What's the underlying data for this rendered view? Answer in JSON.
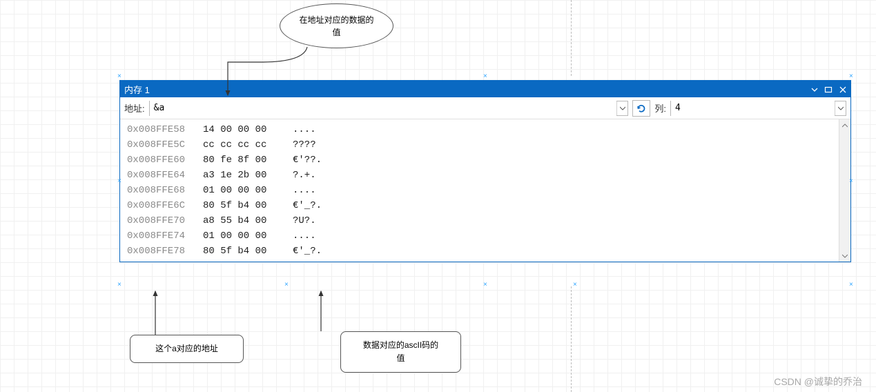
{
  "annotations": {
    "top_ellipse": "在地址对应的数据的\n值",
    "left_box": "这个a对应的地址",
    "right_box": "数据对应的ascII码的\n值"
  },
  "window": {
    "title": "内存 1",
    "addr_label": "地址:",
    "addr_value": "&a",
    "col_label": "列:",
    "col_value": "4"
  },
  "memory": {
    "rows": [
      {
        "addr": "0x008FFE58",
        "hex": "14 00 00 00",
        "asc": "...."
      },
      {
        "addr": "0x008FFE5C",
        "hex": "cc cc cc cc",
        "asc": "????"
      },
      {
        "addr": "0x008FFE60",
        "hex": "80 fe 8f 00",
        "asc": "€'??."
      },
      {
        "addr": "0x008FFE64",
        "hex": "a3 1e 2b 00",
        "asc": "?.+."
      },
      {
        "addr": "0x008FFE68",
        "hex": "01 00 00 00",
        "asc": "...."
      },
      {
        "addr": "0x008FFE6C",
        "hex": "80 5f b4 00",
        "asc": "€'_?."
      },
      {
        "addr": "0x008FFE70",
        "hex": "a8 55 b4 00",
        "asc": "?U?."
      },
      {
        "addr": "0x008FFE74",
        "hex": "01 00 00 00",
        "asc": "...."
      },
      {
        "addr": "0x008FFE78",
        "hex": "80 5f b4 00",
        "asc": "€'_?."
      }
    ]
  },
  "watermark": "CSDN @诚挚的乔治"
}
